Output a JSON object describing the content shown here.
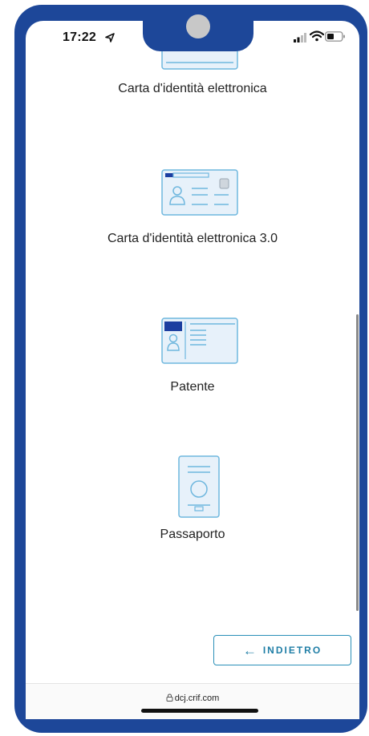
{
  "status_bar": {
    "time": "17:22"
  },
  "documents": [
    {
      "label": "Carta d'identità elettronica",
      "icon": "id-card-icon"
    },
    {
      "label": "Carta d'identità elettronica 3.0",
      "icon": "id-card-3-icon"
    },
    {
      "label": "Patente",
      "icon": "driving-license-icon"
    },
    {
      "label": "Passaporto",
      "icon": "passport-icon"
    }
  ],
  "actions": {
    "back_label": "INDIETRO"
  },
  "browser": {
    "url": "dcj.crif.com"
  },
  "colors": {
    "frame": "#1d4799",
    "accent": "#2a8fb8",
    "icon_blue": "#6fb7de",
    "icon_fill": "#e7f1fa",
    "icon_dark": "#1c3ea0"
  }
}
